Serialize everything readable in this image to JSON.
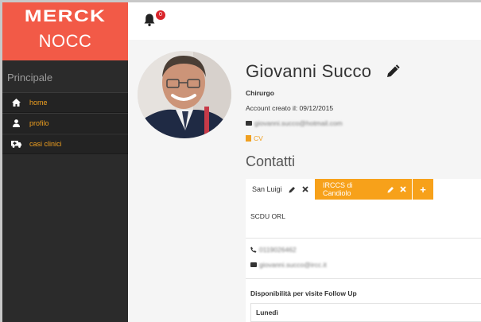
{
  "sidebar": {
    "brand": {
      "logo": "MERCK",
      "subtitle": "NOCC"
    },
    "section_title": "Principale",
    "items": [
      {
        "label": "home",
        "icon": "home-icon"
      },
      {
        "label": "profilo",
        "icon": "user-icon"
      },
      {
        "label": "casi clinici",
        "icon": "ambulance-icon"
      }
    ]
  },
  "topbar": {
    "notification_count": "0"
  },
  "profile": {
    "name": "Giovanni Succo",
    "role": "Chirurgo",
    "created": "Account creato il: 09/12/2015",
    "email": "giovanni.succo@hotmail.com",
    "cv_label": "CV",
    "contacts_title": "Contatti"
  },
  "contacts": {
    "tabs": [
      {
        "label": "San Luigi",
        "active": true
      },
      {
        "label": "IRCCS di Candiolo",
        "active": false
      }
    ],
    "add_label": "+",
    "unit": "SCDU ORL",
    "phone": "0119026462",
    "email": "giovanni.succo@ircc.it",
    "availability_title": "Disponibilità per visite Follow Up",
    "day": "Lunedì"
  },
  "colors": {
    "brand": "#f25a47",
    "accent": "#f7a11a",
    "sidebar": "#2b2b2b",
    "badge": "#d9262c"
  }
}
